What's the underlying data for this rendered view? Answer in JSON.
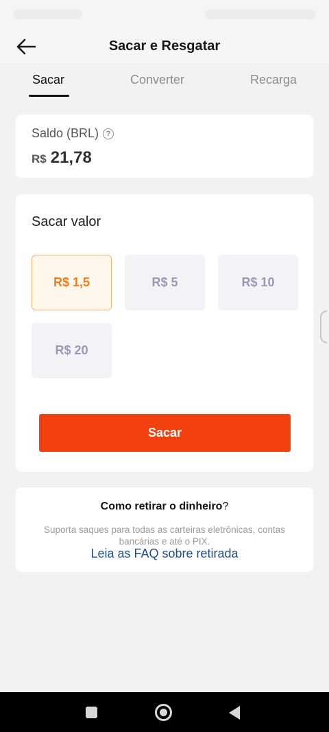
{
  "header": {
    "title": "Sacar e Resgatar",
    "back_icon": "arrow-left-icon"
  },
  "tabs": [
    {
      "label": "Sacar",
      "active": true
    },
    {
      "label": "Converter",
      "active": false
    },
    {
      "label": "Recarga",
      "active": false
    }
  ],
  "balance": {
    "label": "Saldo (BRL)",
    "help_icon": "question-circle-icon",
    "help_glyph": "?",
    "currency": "R$",
    "amount": "21,78"
  },
  "withdraw": {
    "title": "Sacar valor",
    "options": [
      "R$ 1,5",
      "R$ 5",
      "R$ 10",
      "R$ 20"
    ],
    "selected_index": 0,
    "button_label": "Sacar"
  },
  "info": {
    "title": "Como retirar o dinheiro",
    "title_suffix": "?",
    "description": "Suporta saques para todas as carteiras eletrônicas, contas bancárias e até o PIX.",
    "link": "Leia as FAQ sobre retirada"
  },
  "colors": {
    "accent": "#f2400f",
    "selected_text": "#ef7b1a",
    "link": "#1e4f8c"
  },
  "nav": {
    "recents_icon": "square-icon",
    "home_icon": "circle-home-icon",
    "back_icon": "triangle-back-icon"
  }
}
